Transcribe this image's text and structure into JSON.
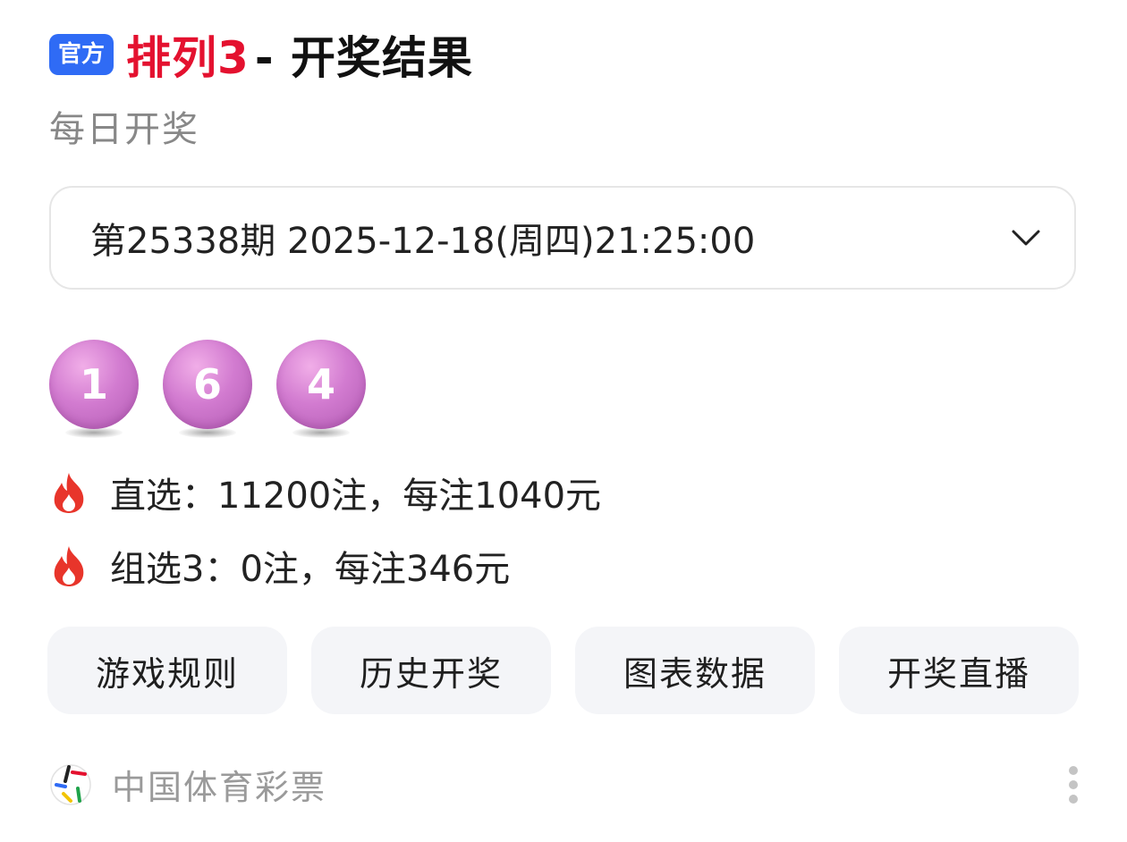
{
  "header": {
    "badge": "官方",
    "lottery_name": "排列3",
    "title_suffix": "- 开奖结果",
    "subtitle": "每日开奖"
  },
  "period_select": {
    "value": "第25338期 2025-12-18(周四)21:25:00",
    "icon": "chevron-down-icon"
  },
  "draw": {
    "numbers": [
      "1",
      "6",
      "4"
    ],
    "ball_color": "#c86fc8"
  },
  "prizes": [
    {
      "icon": "fire-icon",
      "text": "直选：11200注，每注1040元"
    },
    {
      "icon": "fire-icon",
      "text": "组选3：0注，每注346元"
    }
  ],
  "actions": [
    {
      "label": "游戏规则"
    },
    {
      "label": "历史开奖"
    },
    {
      "label": "图表数据"
    },
    {
      "label": "开奖直播"
    }
  ],
  "footer": {
    "source": "中国体育彩票",
    "logo_icon": "china-sports-lottery-logo",
    "more_icon": "more-vertical-icon"
  },
  "colors": {
    "accent_red": "#e4112f",
    "badge_blue": "#2f6bf5",
    "fire": "#e8352b"
  }
}
